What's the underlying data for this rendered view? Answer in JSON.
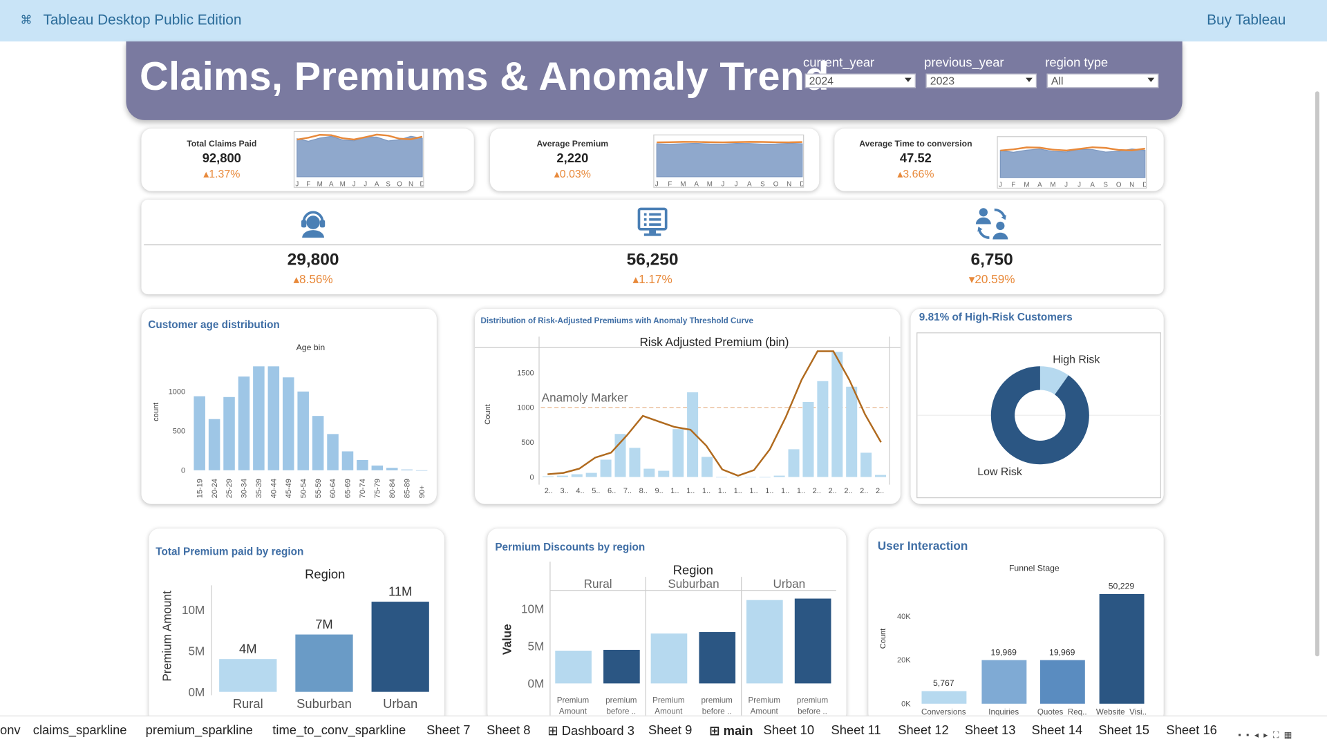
{
  "app": {
    "title": "Tableau Desktop Public Edition",
    "buy": "Buy Tableau"
  },
  "dashboard": {
    "title": "Claims, Premiums & Anomaly Trend"
  },
  "filters": [
    {
      "label": "current_year",
      "value": "2024"
    },
    {
      "label": "previous_year",
      "value": "2023"
    },
    {
      "label": "region type",
      "value": "All"
    }
  ],
  "kpis": [
    {
      "name": "Total Claims Paid",
      "value": "92,800",
      "change": "1.37%",
      "direction": "up"
    },
    {
      "name": "Average Premium",
      "value": "2,220",
      "change": "0.03%",
      "direction": "up"
    },
    {
      "name": "Average Time to conversion",
      "value": "47.52",
      "change": "3.66%",
      "direction": "up"
    }
  ],
  "month_labels": [
    "J",
    "F",
    "M",
    "A",
    "M",
    "J",
    "J",
    "A",
    "S",
    "O",
    "N",
    "D"
  ],
  "stats": [
    {
      "icon": "headset-user-icon",
      "value": "29,800",
      "change": "8.56%",
      "direction": "up"
    },
    {
      "icon": "monitor-form-icon",
      "value": "56,250",
      "change": "1.17%",
      "direction": "up"
    },
    {
      "icon": "user-exchange-icon",
      "value": "6,750",
      "change": "20.59%",
      "direction": "down"
    }
  ],
  "colors": {
    "accent": "#e8893a",
    "header": "#7a7aa0",
    "light_blue": "#a7cce8",
    "mid_blue": "#6a9bc6",
    "dark_blue": "#2b5683"
  },
  "chart_data": [
    {
      "id": "age",
      "type": "bar",
      "title": "Customer age distribution",
      "subtitle": "Age bin",
      "ylabel": "count",
      "categories": [
        "15-19",
        "20-24",
        "25-29",
        "30-34",
        "35-39",
        "40-44",
        "45-49",
        "50-54",
        "55-59",
        "60-64",
        "65-69",
        "70-74",
        "75-79",
        "80-84",
        "85-89",
        "90+"
      ],
      "values": [
        940,
        650,
        930,
        1190,
        1320,
        1320,
        1180,
        1000,
        690,
        460,
        240,
        130,
        60,
        30,
        10,
        0
      ],
      "yticks": [
        "0",
        "500",
        "1000"
      ],
      "ylim": [
        0,
        1450
      ]
    },
    {
      "id": "risk",
      "type": "bar",
      "title": "Distribution of Risk-Adjusted Premiums with Anomaly Threshold Curve",
      "subtitle": "Risk Adjusted Premium (bin)",
      "ylabel": "Count",
      "annotation": "Anamoly Marker",
      "threshold": 1000,
      "categories": [
        "2..",
        "3..",
        "4..",
        "5..",
        "6..",
        "7..",
        "8..",
        "9..",
        "1..",
        "1..",
        "1..",
        "1..",
        "1..",
        "1..",
        "1..",
        "1..",
        "1..",
        "2..",
        "2..",
        "2..",
        "2..",
        "2.."
      ],
      "values": [
        10,
        20,
        40,
        60,
        250,
        620,
        420,
        120,
        90,
        690,
        1220,
        290,
        0,
        0,
        0,
        0,
        20,
        400,
        1080,
        1380,
        1800,
        1300,
        350,
        30
      ],
      "curve": [
        40,
        60,
        120,
        280,
        350,
        600,
        880,
        800,
        720,
        680,
        450,
        110,
        20,
        100,
        400,
        860,
        1400,
        1810,
        1810,
        1400,
        900,
        500
      ],
      "yticks": [
        "0",
        "500",
        "1000",
        "1500"
      ],
      "ylim": [
        0,
        1850
      ]
    },
    {
      "id": "risk_donut",
      "type": "pie",
      "title": "9.81% of High-Risk Customers",
      "labels": [
        "High Risk",
        "Low Risk"
      ],
      "values": [
        9.81,
        90.19
      ]
    },
    {
      "id": "region_total",
      "type": "bar",
      "title": "Total Premium paid by region",
      "subtitle": "Region",
      "ylabel": "Premium Amount",
      "categories": [
        "Rural",
        "Suburban",
        "Urban"
      ],
      "values": [
        4,
        7,
        11
      ],
      "value_labels": [
        "4M",
        "7M",
        "11M"
      ],
      "yticks": [
        "0M",
        "5M",
        "10M"
      ],
      "ylim": [
        0,
        13
      ]
    },
    {
      "id": "region_discounts",
      "type": "bar",
      "title": "Permium Discounts by region",
      "subtitle": "Region",
      "ylabel": "Value",
      "panels": [
        "Rural",
        "Suburban",
        "Urban"
      ],
      "series": [
        {
          "name": "Premium Amount",
          "values": [
            4.4,
            6.7,
            11.2
          ]
        },
        {
          "name": "premium before ..",
          "values": [
            4.5,
            6.9,
            11.4
          ]
        }
      ],
      "series_labels": [
        "Premium Amount",
        "premium before .."
      ],
      "yticks": [
        "0M",
        "5M",
        "10M"
      ],
      "ylim": [
        0,
        12.5
      ]
    },
    {
      "id": "funnel",
      "type": "bar",
      "title": "User Interaction",
      "subtitle": "Funnel Stage",
      "ylabel": "Count",
      "categories": [
        "Conversions",
        "Inquiries",
        "Quotes_Req..",
        "Website_Visi.."
      ],
      "values": [
        5767,
        19969,
        19969,
        50229
      ],
      "value_labels": [
        "5,767",
        "19,969",
        "19,969",
        "50,229"
      ],
      "yticks": [
        "0K",
        "20K",
        "40K"
      ],
      "ylim": [
        0,
        55000
      ]
    }
  ],
  "sheet_tabs": [
    {
      "label": "onv"
    },
    {
      "label": "claims_sparkline"
    },
    {
      "label": "premium_sparkline"
    },
    {
      "label": "time_to_conv_sparkline"
    },
    {
      "label": "Sheet 7"
    },
    {
      "label": "Sheet 8"
    },
    {
      "label": "⊞ Dashboard 3"
    },
    {
      "label": "Sheet 9"
    },
    {
      "label": "⊞ main",
      "active": true
    },
    {
      "label": "Sheet 10"
    },
    {
      "label": "Sheet 11"
    },
    {
      "label": "Sheet 12"
    },
    {
      "label": "Sheet 13"
    },
    {
      "label": "Sheet 14"
    },
    {
      "label": "Sheet 15"
    },
    {
      "label": "Sheet 16"
    }
  ]
}
